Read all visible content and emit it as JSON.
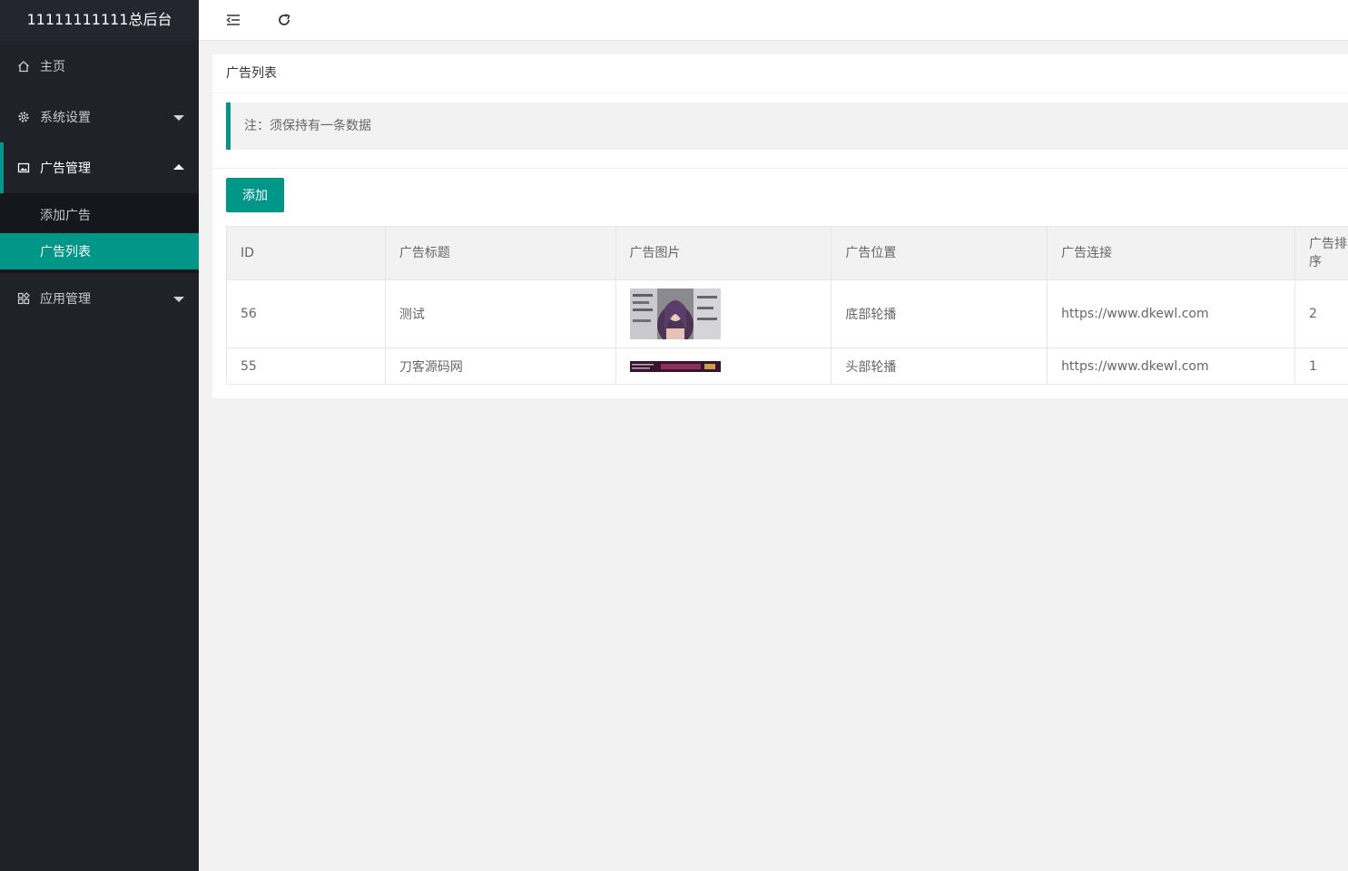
{
  "app": {
    "title": "11111111111总后台"
  },
  "sidebar": {
    "items": [
      {
        "label": "主页",
        "icon": "home-icon"
      },
      {
        "label": "系统设置",
        "icon": "gear-icon"
      },
      {
        "label": "广告管理",
        "icon": "image-icon",
        "sub": [
          "添加广告",
          "广告列表"
        ]
      },
      {
        "label": "应用管理",
        "icon": "apps-icon"
      }
    ]
  },
  "header": {
    "fold_icon": "menu-fold-icon",
    "refresh_icon": "refresh-icon"
  },
  "card": {
    "title": "广告列表",
    "note": "注：须保持有一条数据",
    "add_label": "添加"
  },
  "table": {
    "headers": [
      "ID",
      "广告标题",
      "广告图片",
      "广告位置",
      "广告连接",
      "广告排序"
    ],
    "rows": [
      {
        "id": "56",
        "title": "测试",
        "position": "底部轮播",
        "link": "https://www.dkewl.com",
        "sort": "2"
      },
      {
        "id": "55",
        "title": "刀客源码网",
        "position": "头部轮播",
        "link": "https://www.dkewl.com",
        "sort": "1"
      }
    ]
  },
  "colors": {
    "accent": "#009688",
    "sidebar_bg": "#20222a"
  }
}
